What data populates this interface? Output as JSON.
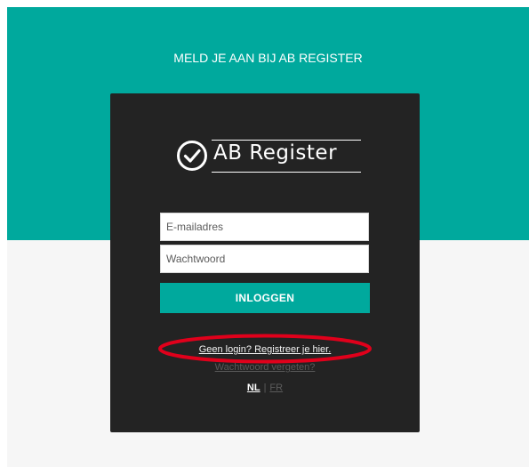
{
  "hero": {
    "title": "MELD JE AAN BIJ AB REGISTER"
  },
  "logo": {
    "text": "AB Register",
    "icon": "check-circle-icon"
  },
  "form": {
    "email_placeholder": "E-mailadres",
    "password_placeholder": "Wachtwoord",
    "login_label": "INLOGGEN"
  },
  "links": {
    "register": "Geen login? Registreer je hier.",
    "forgot": "Wachtwoord vergeten?"
  },
  "languages": {
    "nl": "NL",
    "separator": "|",
    "fr": "FR"
  },
  "colors": {
    "teal": "#00a99d",
    "card": "#232323",
    "highlight": "#e0001b"
  }
}
